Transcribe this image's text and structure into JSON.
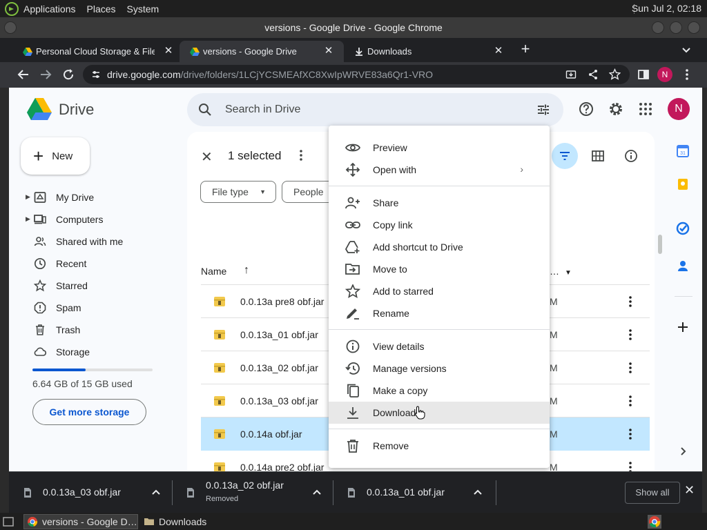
{
  "panel": {
    "menu": [
      "Applications",
      "Places",
      "System"
    ],
    "clock": "Sun Jul  2, 02:18"
  },
  "window": {
    "title": "versions - Google Drive - Google Chrome"
  },
  "tabs": [
    {
      "title": "Personal Cloud Storage & File",
      "favicon": "google-drive-icon"
    },
    {
      "title": "versions - Google Drive",
      "favicon": "google-drive-icon",
      "active": true
    },
    {
      "title": "Downloads",
      "favicon": "download-icon"
    }
  ],
  "address": {
    "host": "drive.google.com",
    "path": "/drive/folders/1LCjYCSMEAfXC8XwIpWRVE83a6Qr1-VRO"
  },
  "profile": {
    "initial": "N",
    "color": "#c2185b"
  },
  "drive": {
    "app_name": "Drive",
    "search_placeholder": "Search in Drive",
    "new_label": "New",
    "nav": [
      {
        "label": "My Drive",
        "icon": "my-drive-icon",
        "expandable": true
      },
      {
        "label": "Computers",
        "icon": "computers-icon",
        "expandable": true
      },
      {
        "label": "Shared with me",
        "icon": "shared-icon"
      },
      {
        "label": "Recent",
        "icon": "clock-icon"
      },
      {
        "label": "Starred",
        "icon": "star-icon"
      },
      {
        "label": "Spam",
        "icon": "spam-icon"
      },
      {
        "label": "Trash",
        "icon": "trash-icon"
      },
      {
        "label": "Storage",
        "icon": "cloud-icon"
      }
    ],
    "storage": {
      "used_text": "6.64 GB of 15 GB used",
      "fraction": 0.443,
      "button": "Get more storage"
    }
  },
  "main": {
    "selected_text": "1 selected",
    "chips": [
      "File type",
      "People"
    ],
    "col_name": "Name",
    "col_modified": "…",
    "files": [
      {
        "name": "0.0.13a pre8 obf.jar",
        "modified": "M"
      },
      {
        "name": "0.0.13a_01 obf.jar",
        "modified": "M"
      },
      {
        "name": "0.0.13a_02 obf.jar",
        "modified": "M"
      },
      {
        "name": "0.0.13a_03 obf.jar",
        "modified": "M"
      },
      {
        "name": "0.0.14a obf.jar",
        "modified": "M",
        "selected": true
      },
      {
        "name": "0.0.14a pre2 obf.jar",
        "modified": "M"
      },
      {
        "name": "0.0.14a  01 obf.jar",
        "modified": "M"
      }
    ]
  },
  "context_menu": {
    "groups": [
      [
        {
          "label": "Preview",
          "icon": "eye-icon"
        },
        {
          "label": "Open with",
          "icon": "open-with-icon",
          "submenu": true
        }
      ],
      [
        {
          "label": "Share",
          "icon": "share-person-icon"
        },
        {
          "label": "Copy link",
          "icon": "link-icon"
        },
        {
          "label": "Add shortcut to Drive",
          "icon": "add-shortcut-icon"
        },
        {
          "label": "Move to",
          "icon": "move-folder-icon"
        },
        {
          "label": "Add to starred",
          "icon": "star-outline-icon"
        },
        {
          "label": "Rename",
          "icon": "pencil-icon"
        }
      ],
      [
        {
          "label": "View details",
          "icon": "info-icon"
        },
        {
          "label": "Manage versions",
          "icon": "history-icon"
        },
        {
          "label": "Make a copy",
          "icon": "copy-icon"
        },
        {
          "label": "Download",
          "icon": "download-icon",
          "hovered": true
        }
      ],
      [
        {
          "label": "Remove",
          "icon": "trash-icon"
        }
      ]
    ]
  },
  "downloads": {
    "items": [
      {
        "name": "0.0.13a_03 obf.jar",
        "status": ""
      },
      {
        "name": "0.0.13a_02 obf.jar",
        "status": "Removed"
      },
      {
        "name": "0.0.13a_01 obf.jar",
        "status": ""
      }
    ],
    "show_all": "Show all"
  },
  "taskbar": {
    "tasks": [
      {
        "label": "versions - Google D…",
        "active": true
      },
      {
        "label": "Downloads"
      }
    ]
  },
  "colors": {
    "accent": "#0b57d0",
    "selected_row": "#c2e7ff",
    "avatar": "#c2185b"
  }
}
